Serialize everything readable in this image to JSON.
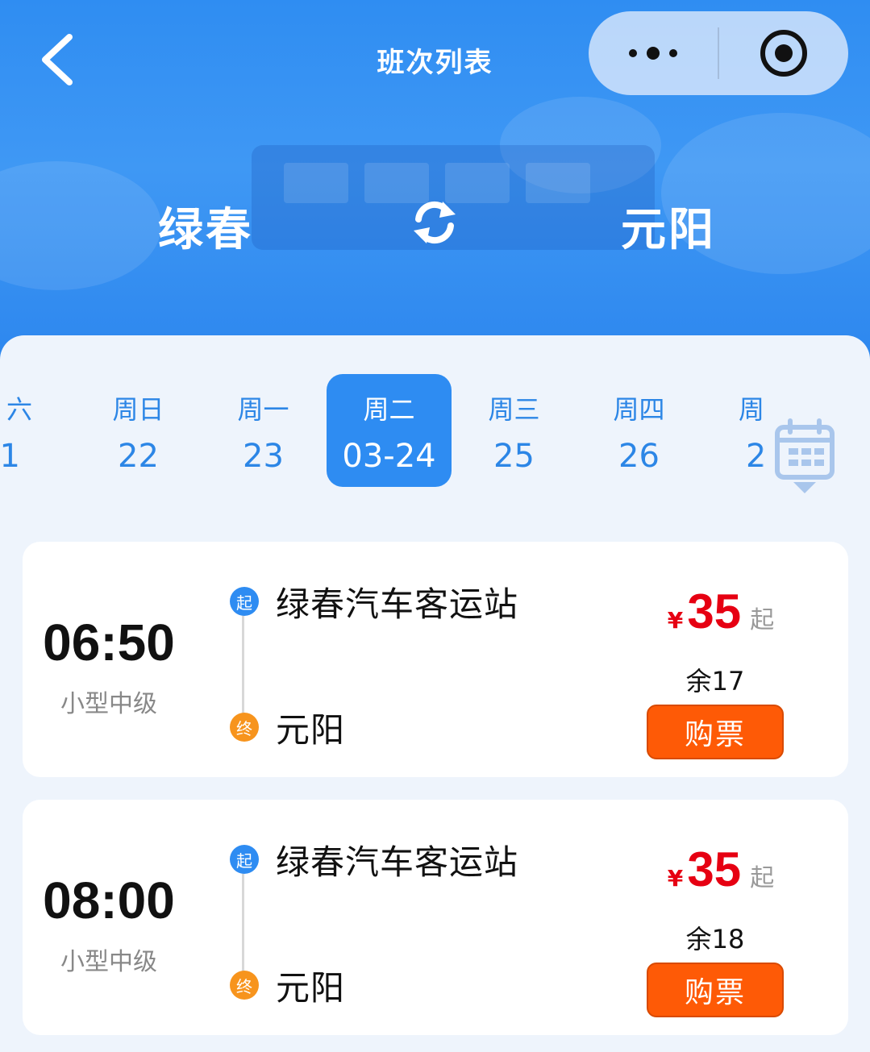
{
  "header": {
    "title": "班次列表",
    "back_icon": "chevron-left-icon",
    "capsule": {
      "more_icon": "more-dots-icon",
      "close_icon": "target-close-icon"
    },
    "route": {
      "from": "绿春",
      "to": "元阳",
      "swap_icon": "swap-refresh-icon"
    }
  },
  "dates": [
    {
      "weekday": "六",
      "day": "1"
    },
    {
      "weekday": "周日",
      "day": "22"
    },
    {
      "weekday": "周一",
      "day": "23"
    },
    {
      "weekday": "周二",
      "day": "03-24",
      "selected": true
    },
    {
      "weekday": "周三",
      "day": "25"
    },
    {
      "weekday": "周四",
      "day": "26"
    },
    {
      "weekday": "周",
      "day": "2"
    }
  ],
  "calendar_icon": "calendar-icon",
  "trips": [
    {
      "time": "06:50",
      "bus_type": "小型中级",
      "start_badge": "起",
      "end_badge": "终",
      "from_station": "绿春汽车客运站",
      "to_station": "元阳",
      "currency": "¥",
      "price": "35",
      "price_suffix": "起",
      "remaining": "余17",
      "buy_label": "购票"
    },
    {
      "time": "08:00",
      "bus_type": "小型中级",
      "start_badge": "起",
      "end_badge": "终",
      "from_station": "绿春汽车客运站",
      "to_station": "元阳",
      "currency": "¥",
      "price": "35",
      "price_suffix": "起",
      "remaining": "余18",
      "buy_label": "购票"
    }
  ],
  "colors": {
    "primary": "#2e8cf2",
    "price": "#e60012",
    "buy_button": "#fe5a06",
    "end_badge": "#f7941d"
  }
}
